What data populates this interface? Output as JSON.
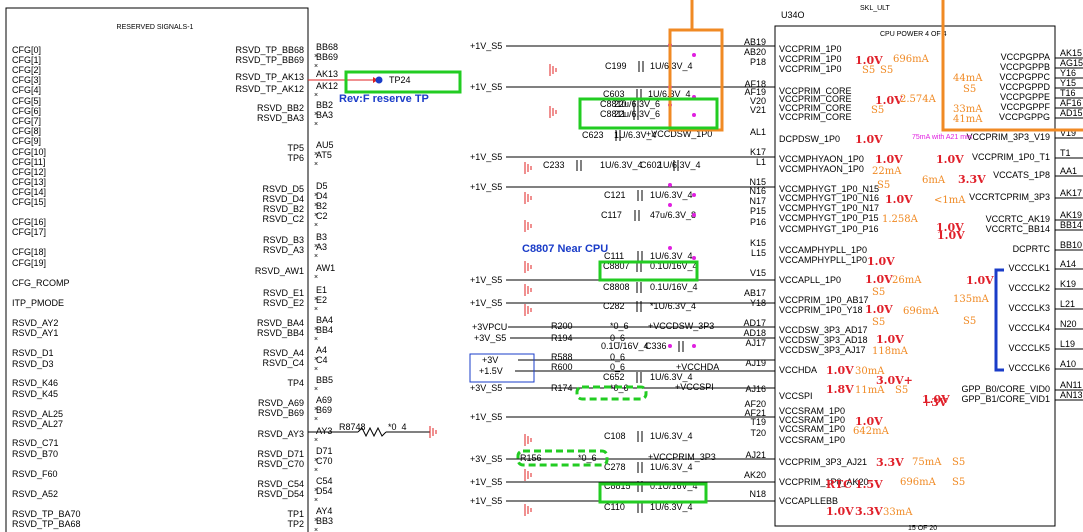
{
  "left_block": {
    "title": "RESERVED SIGNALS-1",
    "cfg_pins": [
      "CFG[0]",
      "CFG[1]",
      "CFG[2]",
      "CFG[3]",
      "CFG[4]",
      "CFG[5]",
      "CFG[6]",
      "CFG[7]",
      "CFG[8]",
      "CFG[9]",
      "CFG[10]",
      "CFG[11]",
      "CFG[12]",
      "CFG[13]",
      "CFG[14]",
      "CFG[15]",
      "CFG[16]",
      "CFG[17]",
      "CFG[18]",
      "CFG[19]",
      "CFG_RCOMP",
      "ITP_PMODE",
      "RSVD_AY2",
      "RSVD_AY1",
      "RSVD_D1",
      "RSVD_D3",
      "RSVD_K46",
      "RSVD_K45",
      "RSVD_AL25",
      "RSVD_AL27",
      "RSVD_C71",
      "RSVD_B70",
      "RSVD_F60",
      "RSVD_A52",
      "RSVD_TP_BA70",
      "RSVD_TP_BA68"
    ],
    "right_pins": [
      {
        "name": "RSVD_TP_BB68",
        "ball": "BB68"
      },
      {
        "name": "RSVD_TP_BB69",
        "ball": "BB69"
      },
      {
        "name": "RSVD_TP_AK13",
        "ball": "AK13"
      },
      {
        "name": "RSVD_TP_AK12",
        "ball": "AK12"
      },
      {
        "name": "RSVD_BB2",
        "ball": "BB2"
      },
      {
        "name": "RSVD_BA3",
        "ball": "BA3"
      },
      {
        "name": "TP5",
        "ball": "AU5"
      },
      {
        "name": "TP6",
        "ball": "AT5"
      },
      {
        "name": "RSVD_D5",
        "ball": "D5"
      },
      {
        "name": "RSVD_D4",
        "ball": "D4"
      },
      {
        "name": "RSVD_B2",
        "ball": "B2"
      },
      {
        "name": "RSVD_C2",
        "ball": "C2"
      },
      {
        "name": "RSVD_B3",
        "ball": "B3"
      },
      {
        "name": "RSVD_A3",
        "ball": "A3"
      },
      {
        "name": "RSVD_AW1",
        "ball": "AW1"
      },
      {
        "name": "RSVD_E1",
        "ball": "E1"
      },
      {
        "name": "RSVD_E2",
        "ball": "E2"
      },
      {
        "name": "RSVD_BA4",
        "ball": "BA4"
      },
      {
        "name": "RSVD_BB4",
        "ball": "BB4"
      },
      {
        "name": "RSVD_A4",
        "ball": "A4"
      },
      {
        "name": "RSVD_C4",
        "ball": "C4"
      },
      {
        "name": "TP4",
        "ball": "BB5"
      },
      {
        "name": "RSVD_A69",
        "ball": "A69"
      },
      {
        "name": "RSVD_B69",
        "ball": "B69"
      },
      {
        "name": "RSVD_AY3",
        "ball": "AY3"
      },
      {
        "name": "RSVD_D71",
        "ball": "D71"
      },
      {
        "name": "RSVD_C70",
        "ball": "C70"
      },
      {
        "name": "RSVD_C54",
        "ball": "C54"
      },
      {
        "name": "RSVD_D54",
        "ball": "D54"
      },
      {
        "name": "TP1",
        "ball": "AY4"
      },
      {
        "name": "TP2",
        "ball": "BB3"
      }
    ],
    "tp24": "TP24",
    "rev_note": "Rev:F reserve TP",
    "r8748": "R8748",
    "r8748_val": "*0_4"
  },
  "middle": {
    "near_cpu_note": "C8807 Near CPU",
    "rails": [
      "+1V_S5",
      "+1V_S5",
      "+1V_S5",
      "+1V_S5",
      "+1V_S5",
      "+1V_S5",
      "+1V_S5",
      "+1V_S5",
      "+1V_S5",
      "+3VPCU",
      "+3V_S5",
      "+3V",
      "+1.5V",
      "+3V_S5",
      "+1V_S5",
      "+3V_S5",
      "+1V_S5",
      "+1V_S5"
    ],
    "caps": [
      {
        "ref": "C199",
        "val": "1U/6.3V_4"
      },
      {
        "ref": "C603",
        "val": "1U/6.3V_4"
      },
      {
        "ref": "C8810",
        "val": "22u/6.3V_6"
      },
      {
        "ref": "C8811",
        "val": "22u/6.3V_6"
      },
      {
        "ref": "C623",
        "val": "1U/6.3V_4"
      },
      {
        "ref": "C233",
        "val": "1U/6.3V_4"
      },
      {
        "ref": "C602",
        "val": "1U/6.3V_4"
      },
      {
        "ref": "C121",
        "val": "1U/6.3V_4"
      },
      {
        "ref": "C117",
        "val": "47u/6.3V_8"
      },
      {
        "ref": "C111",
        "val": "1U/6.3V_4"
      },
      {
        "ref": "C8807",
        "val": "0.1U/16V_4"
      },
      {
        "ref": "C8808",
        "val": "0.1U/16V_4"
      },
      {
        "ref": "C282",
        "val": "*1U/6.3V_4"
      },
      {
        "ref": "C336",
        "val": "0.1U/16V_4"
      },
      {
        "ref": "C652",
        "val": "1U/6.3V_4"
      },
      {
        "ref": "C108",
        "val": "1U/6.3V_4"
      },
      {
        "ref": "C278",
        "val": "1U/6.3V_4"
      },
      {
        "ref": "C8815",
        "val": "0.1U/16V_4"
      },
      {
        "ref": "C110",
        "val": "1U/6.3V_4"
      }
    ],
    "resistors": [
      {
        "ref": "R200",
        "val": "*0_6"
      },
      {
        "ref": "R194",
        "val": "0_6"
      },
      {
        "ref": "R588",
        "val": "0_6"
      },
      {
        "ref": "R600",
        "val": "0_6"
      },
      {
        "ref": "R174",
        "val": "*0_6"
      },
      {
        "ref": "R156",
        "val": "*0_6"
      }
    ],
    "net_labels": [
      "+VCCDSW_1P0",
      "+VCCDSW_3P3",
      "+VCCHDA",
      "+VCCSPI",
      "+VCCPRIM_3P3"
    ]
  },
  "cpu_block": {
    "ref": "U34O",
    "part": "SKL_ULT",
    "title": "CPU POWER 4 OF 4",
    "left_pins": [
      {
        "ball": "AB19",
        "name": "VCCPRIM_1P0"
      },
      {
        "ball": "AB20",
        "name": "VCCPRIM_1P0"
      },
      {
        "ball": "P18",
        "name": "VCCPRIM_1P0"
      },
      {
        "ball": "AF18",
        "name": "VCCPRIM_CORE"
      },
      {
        "ball": "AF19",
        "name": "VCCPRIM_CORE"
      },
      {
        "ball": "V20",
        "name": "VCCPRIM_CORE"
      },
      {
        "ball": "V21",
        "name": "VCCPRIM_CORE"
      },
      {
        "ball": "AL1",
        "name": "DCPDSW_1P0"
      },
      {
        "ball": "K17",
        "name": "VCCMPHYAON_1P0"
      },
      {
        "ball": "L1",
        "name": "VCCMPHYAON_1P0"
      },
      {
        "ball": "N15",
        "name": "VCCMPHYGT_1P0_N15"
      },
      {
        "ball": "N16",
        "name": "VCCMPHYGT_1P0_N16"
      },
      {
        "ball": "N17",
        "name": "VCCMPHYGT_1P0_N17"
      },
      {
        "ball": "P15",
        "name": "VCCMPHYGT_1P0_P15"
      },
      {
        "ball": "P16",
        "name": "VCCMPHYGT_1P0_P16"
      },
      {
        "ball": "K15",
        "name": "VCCAMPHYPLL_1P0"
      },
      {
        "ball": "L15",
        "name": "VCCAMPHYPLL_1P0"
      },
      {
        "ball": "V15",
        "name": "VCCAPLL_1P0"
      },
      {
        "ball": "AB17",
        "name": "VCCPRIM_1P0_AB17"
      },
      {
        "ball": "Y18",
        "name": "VCCPRIM_1P0_Y18"
      },
      {
        "ball": "AD17",
        "name": "VCCDSW_3P3_AD17"
      },
      {
        "ball": "AD18",
        "name": "VCCDSW_3P3_AD18"
      },
      {
        "ball": "AJ17",
        "name": "VCCDSW_3P3_AJ17"
      },
      {
        "ball": "AJ19",
        "name": "VCCHDA"
      },
      {
        "ball": "AJ16",
        "name": "VCCSPI"
      },
      {
        "ball": "AF20",
        "name": "VCCSRAM_1P0"
      },
      {
        "ball": "AF21",
        "name": "VCCSRAM_1P0"
      },
      {
        "ball": "T19",
        "name": "VCCSRAM_1P0"
      },
      {
        "ball": "T20",
        "name": "VCCSRAM_1P0"
      },
      {
        "ball": "AJ21",
        "name": "VCCPRIM_3P3_AJ21"
      },
      {
        "ball": "AK20",
        "name": "VCCPRIM_1P0_AK20"
      },
      {
        "ball": "N18",
        "name": "VCCAPLLEBB"
      }
    ],
    "right_pins": [
      {
        "ball": "AK15",
        "name": "VCCPGPPA"
      },
      {
        "ball": "AG15",
        "name": "VCCPGPPB"
      },
      {
        "ball": "Y16",
        "name": "VCCPGPPC"
      },
      {
        "ball": "Y15",
        "name": "VCCPGPPD"
      },
      {
        "ball": "T16",
        "name": "VCCPGPPE"
      },
      {
        "ball": "AF16",
        "name": "VCCPGPPF"
      },
      {
        "ball": "AD15",
        "name": "VCCPGPPG"
      },
      {
        "ball": "V19",
        "name": "VCCPRIM_3P3_V19"
      },
      {
        "ball": "T1",
        "name": "VCCPRIM_1P0_T1"
      },
      {
        "ball": "AA1",
        "name": "VCCATS_1P8"
      },
      {
        "ball": "AK17",
        "name": "VCCRTCPRIM_3P3"
      },
      {
        "ball": "AK19",
        "name": "VCCRTC_AK19"
      },
      {
        "ball": "BB14",
        "name": "VCCRTC_BB14"
      },
      {
        "ball": "BB10",
        "name": "DCPRTC"
      },
      {
        "ball": "A14",
        "name": "VCCCLK1"
      },
      {
        "ball": "K19",
        "name": "VCCCLK2"
      },
      {
        "ball": "L21",
        "name": "VCCCLK3"
      },
      {
        "ball": "N20",
        "name": "VCCCLK4"
      },
      {
        "ball": "L19",
        "name": "VCCCLK5"
      },
      {
        "ball": "A10",
        "name": "VCCCLK6"
      },
      {
        "ball": "AN11",
        "name": "GPP_B0/CORE_VID0"
      },
      {
        "ball": "AN13",
        "name": "GPP_B1/CORE_VID1"
      }
    ],
    "footer": "15 OF 20"
  },
  "annotations": {
    "red": [
      "1.0V",
      "1.0V",
      "1.0V",
      "1.0V",
      "1.0V",
      "1.0V",
      "1.0V",
      "1.0V",
      "1.0V",
      "1.0V",
      "1.0V",
      "3.3V",
      "1.5V",
      "3.3V",
      "1.0V",
      "3.3V",
      "1.0V",
      "1.0V",
      "1.0V",
      "1.0V",
      "1.8V",
      "3.0V+",
      "RTC",
      "1.0V",
      "+3V"
    ],
    "orange": [
      "696mA",
      "S5",
      "2.574A",
      "S5",
      "22mA",
      "S5",
      "1.258A",
      "26mA",
      "S5",
      "696mA",
      "S5",
      "118mA",
      "30mA",
      "11mA",
      "S5",
      "642mA",
      "75mA",
      "S5",
      "696mA",
      "S5",
      "33mA",
      "44mA",
      "S5",
      "33mA",
      "41mA",
      "6mA",
      "<1mA",
      "135mA",
      "S5",
      "S5"
    ],
    "purple_note": "75mA with A21 mm"
  },
  "colors": {
    "green": "#22cc22",
    "orange": "#f08a24",
    "red": "#e02020",
    "magenta": "#e020e0",
    "blue": "#1a3cc8"
  }
}
